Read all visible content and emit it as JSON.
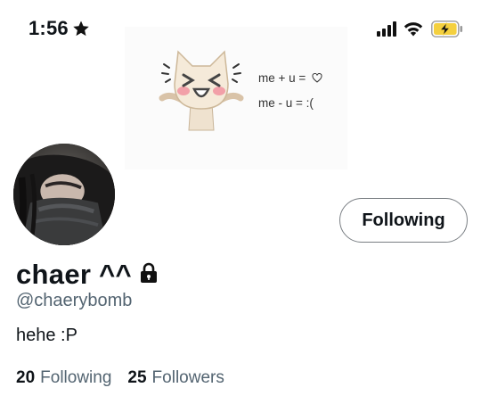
{
  "status_bar": {
    "time": "1:56",
    "icons": [
      "star-icon",
      "signal-icon",
      "wifi-icon",
      "battery-charging-icon"
    ],
    "battery_color": "#f4d03f"
  },
  "header": {
    "banner_line_1": "me + u =",
    "banner_line_2": "me - u = :(",
    "art": "cat-icon"
  },
  "profile": {
    "display_name": "chaer ^^",
    "handle": "@chaerybomb",
    "bio": "hehe :P",
    "follow_button_label": "Following",
    "protected": true
  },
  "stats": {
    "following_count": "20",
    "following_label": "Following",
    "followers_count": "25",
    "followers_label": "Followers"
  },
  "colors": {
    "text_primary": "#0f1419",
    "text_secondary": "#536471",
    "button_border": "#7a7f84"
  }
}
